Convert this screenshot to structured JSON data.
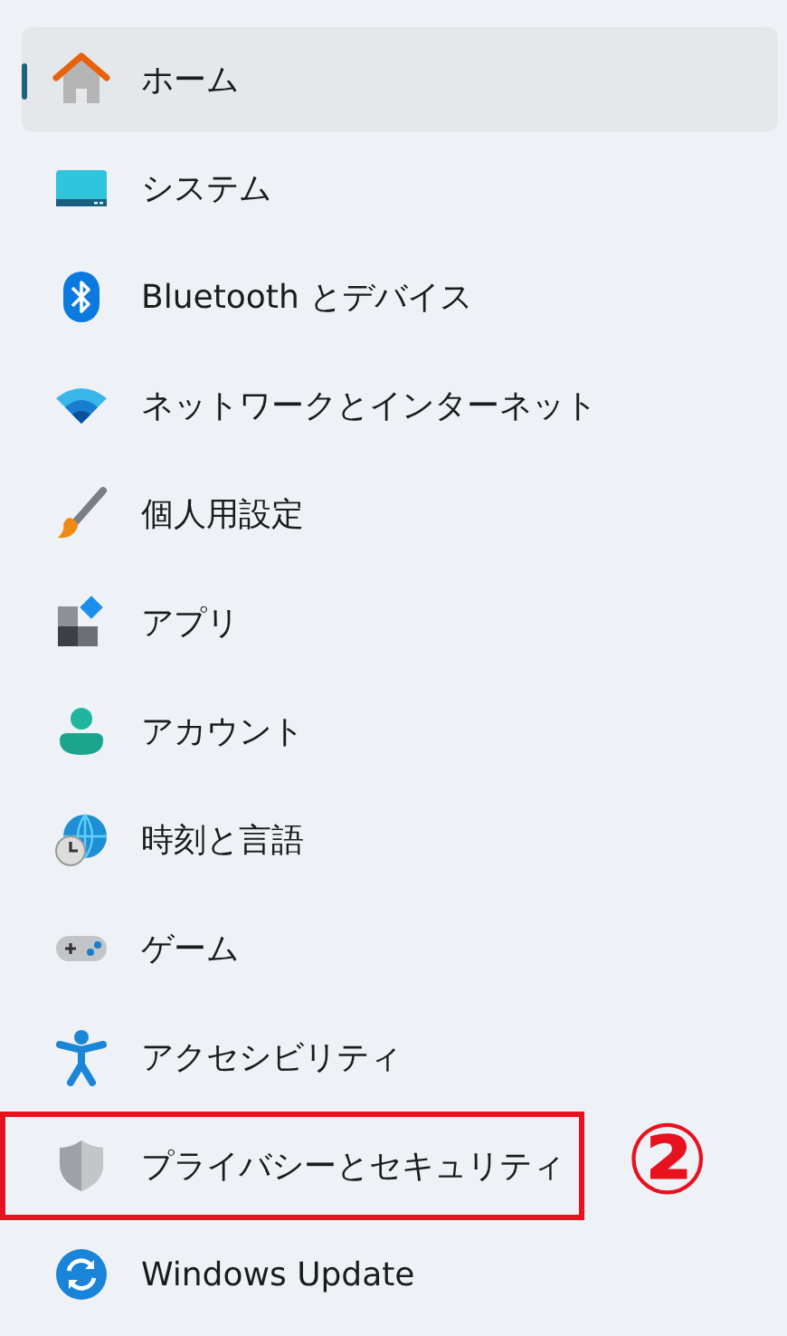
{
  "nav_items": [
    {
      "label": "ホーム",
      "selected": true,
      "highlighted": false
    },
    {
      "label": "システム",
      "selected": false,
      "highlighted": false
    },
    {
      "label": "Bluetooth とデバイス",
      "selected": false,
      "highlighted": false
    },
    {
      "label": "ネットワークとインターネット",
      "selected": false,
      "highlighted": false
    },
    {
      "label": "個人用設定",
      "selected": false,
      "highlighted": false
    },
    {
      "label": "アプリ",
      "selected": false,
      "highlighted": false
    },
    {
      "label": "アカウント",
      "selected": false,
      "highlighted": false
    },
    {
      "label": "時刻と言語",
      "selected": false,
      "highlighted": false
    },
    {
      "label": "ゲーム",
      "selected": false,
      "highlighted": false
    },
    {
      "label": "アクセシビリティ",
      "selected": false,
      "highlighted": false
    },
    {
      "label": "プライバシーとセキュリティ",
      "selected": false,
      "highlighted": true,
      "callout": "②"
    },
    {
      "label": "Windows Update",
      "selected": false,
      "highlighted": false
    }
  ]
}
